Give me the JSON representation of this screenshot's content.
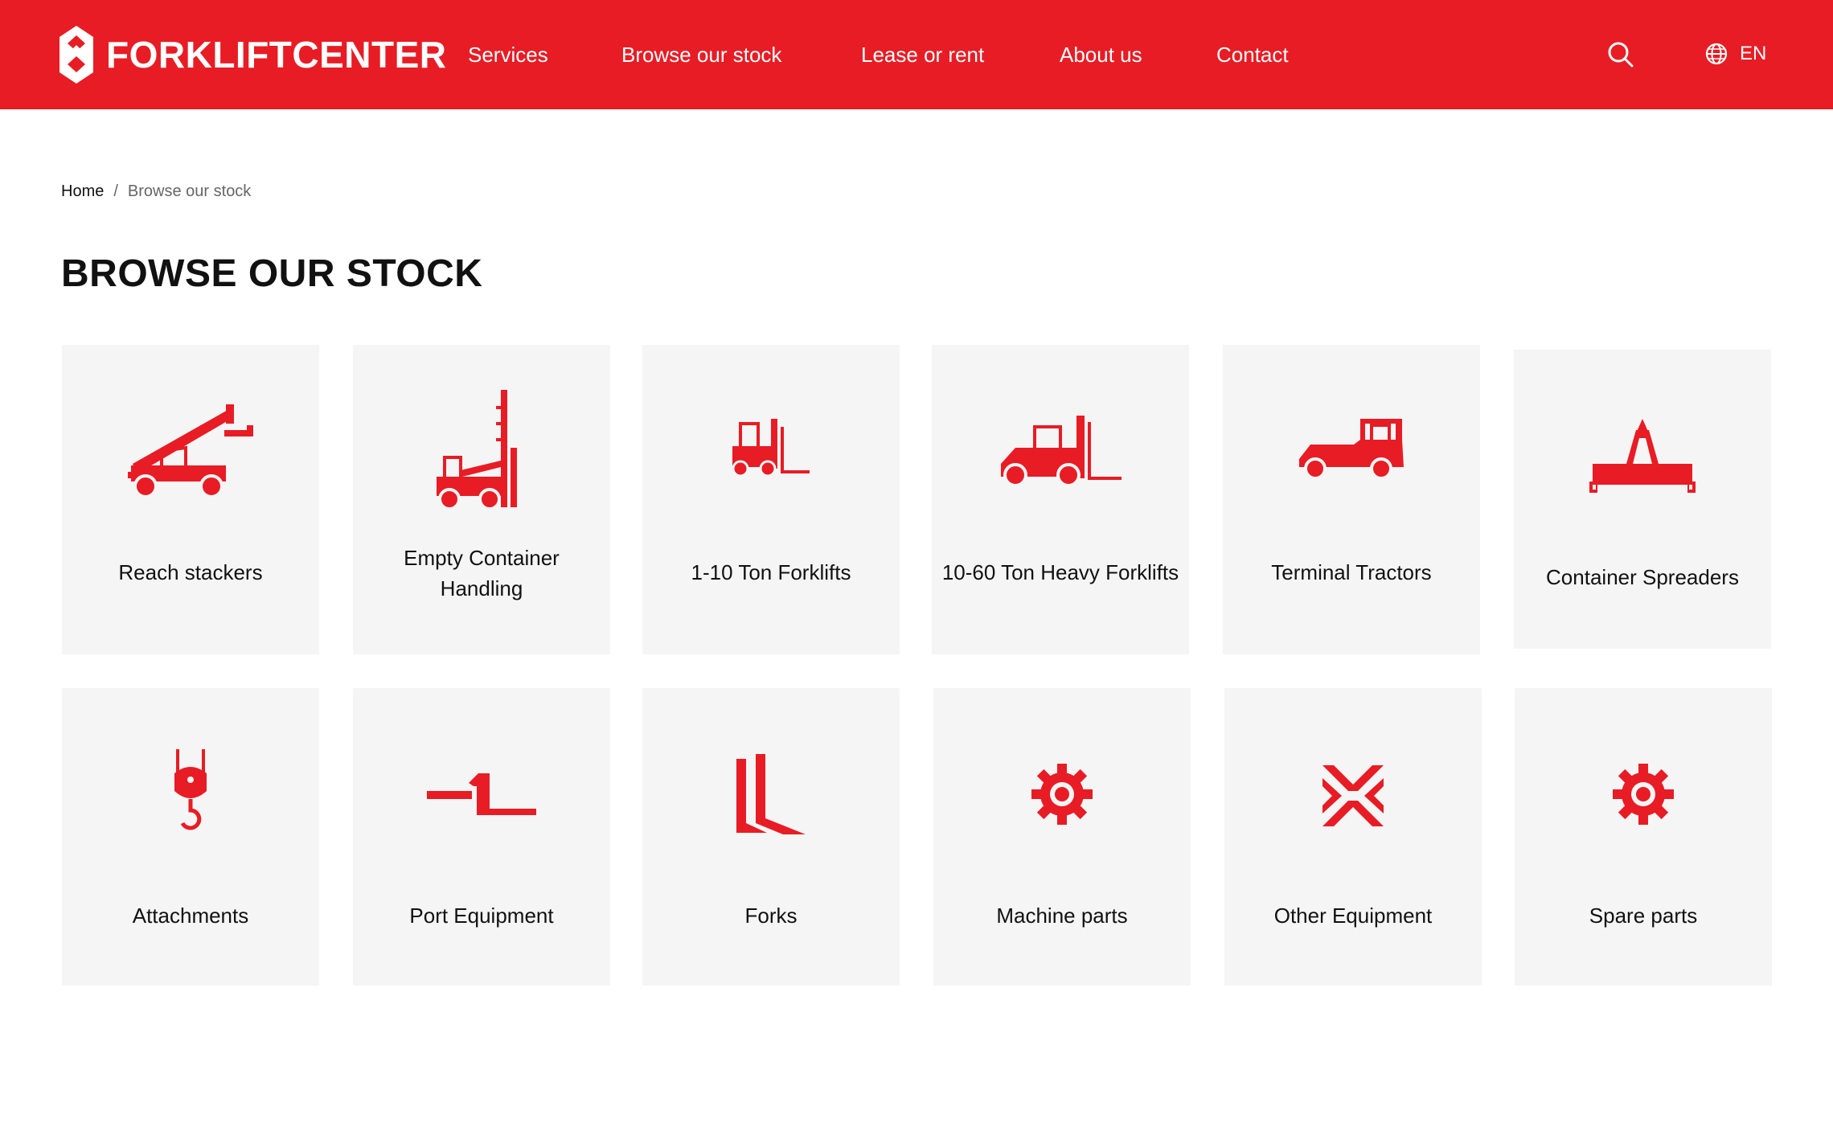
{
  "header": {
    "brand": "FORKLIFTCENTER",
    "nav": [
      {
        "label": "Services"
      },
      {
        "label": "Browse our stock"
      },
      {
        "label": "Lease or rent"
      },
      {
        "label": "About us"
      },
      {
        "label": "Contact"
      }
    ],
    "language": "EN"
  },
  "breadcrumb": {
    "home": "Home",
    "separator": "/",
    "current": "Browse our stock"
  },
  "page_title": "BROWSE OUR STOCK",
  "categories": [
    {
      "label": "Reach stackers",
      "icon": "reach-stacker-icon"
    },
    {
      "label": "Empty Container Handling",
      "icon": "container-handler-icon"
    },
    {
      "label": "1-10 Ton Forklifts",
      "icon": "small-forklift-icon"
    },
    {
      "label": "10-60 Ton Heavy Forklifts",
      "icon": "heavy-forklift-icon"
    },
    {
      "label": "Terminal Tractors",
      "icon": "terminal-tractor-icon"
    },
    {
      "label": "Container Spreaders",
      "icon": "spreader-icon"
    },
    {
      "label": "Attachments",
      "icon": "hook-icon"
    },
    {
      "label": "Port Equipment",
      "icon": "port-equipment-icon"
    },
    {
      "label": "Forks",
      "icon": "forks-icon"
    },
    {
      "label": "Machine parts",
      "icon": "gear-icon"
    },
    {
      "label": "Other Equipment",
      "icon": "cross-arrows-icon"
    },
    {
      "label": "Spare parts",
      "icon": "gear-icon"
    }
  ],
  "colors": {
    "brand": "#e81c24",
    "card_bg": "#f5f5f5",
    "text": "#111111"
  }
}
